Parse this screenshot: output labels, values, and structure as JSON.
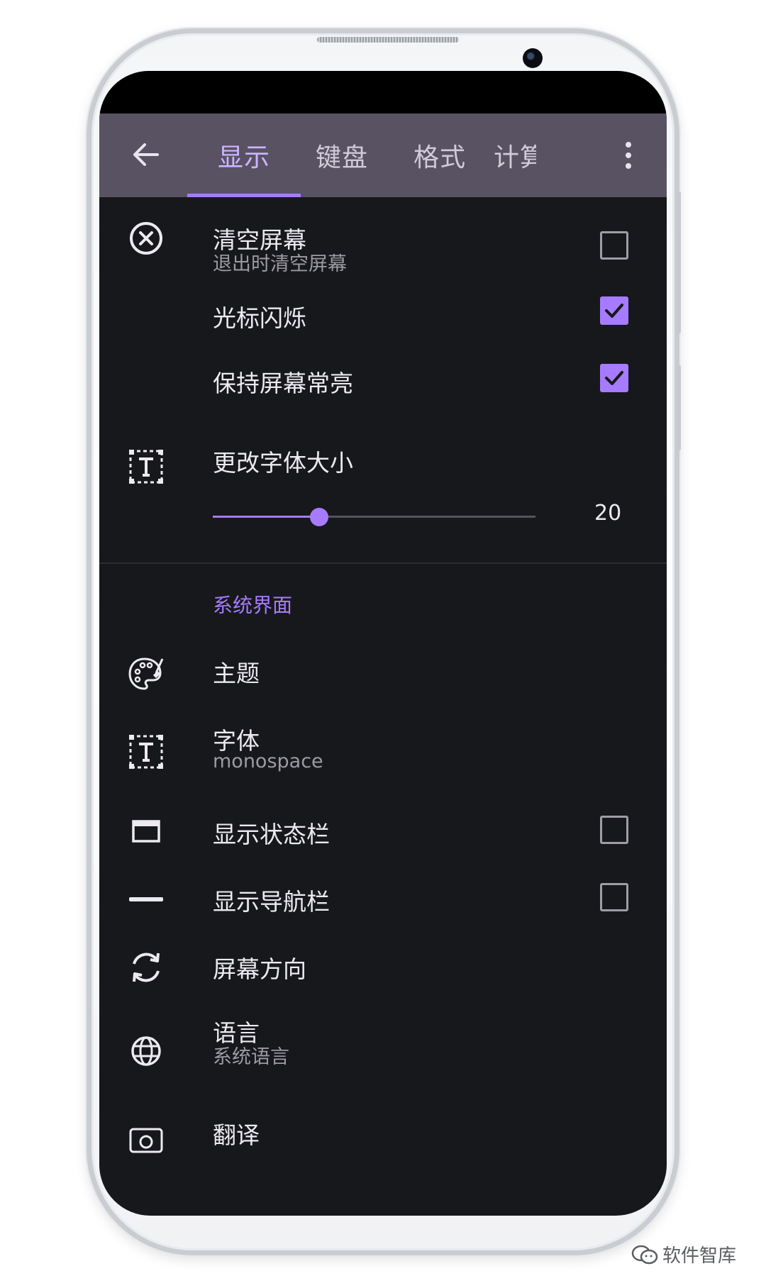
{
  "appbar": {
    "tabs": [
      {
        "label": "显示"
      },
      {
        "label": "键盘"
      },
      {
        "label": "格式"
      },
      {
        "label": "计算"
      }
    ]
  },
  "settings": {
    "clear_screen": {
      "title": "清空屏幕",
      "summary": "退出时清空屏幕",
      "checked": false
    },
    "cursor_blink": {
      "title": "光标闪烁",
      "checked": true
    },
    "keep_screen_on": {
      "title": "保持屏幕常亮",
      "checked": true
    },
    "font_size": {
      "title": "更改字体大小",
      "value": "20",
      "level": 0.33
    },
    "category_system_ui": "系统界面",
    "theme": {
      "title": "主题"
    },
    "font": {
      "title": "字体",
      "summary": "monospace"
    },
    "show_status_bar": {
      "title": "显示状态栏",
      "checked": false
    },
    "show_nav_bar": {
      "title": "显示导航栏",
      "checked": false
    },
    "orientation": {
      "title": "屏幕方向"
    },
    "language": {
      "title": "语言",
      "summary": "系统语言"
    },
    "translate": {
      "title": "翻译"
    }
  },
  "watermark": "软件智库",
  "colors": {
    "accent": "#a77bff",
    "appbar": "#585263",
    "background": "#17181b"
  }
}
